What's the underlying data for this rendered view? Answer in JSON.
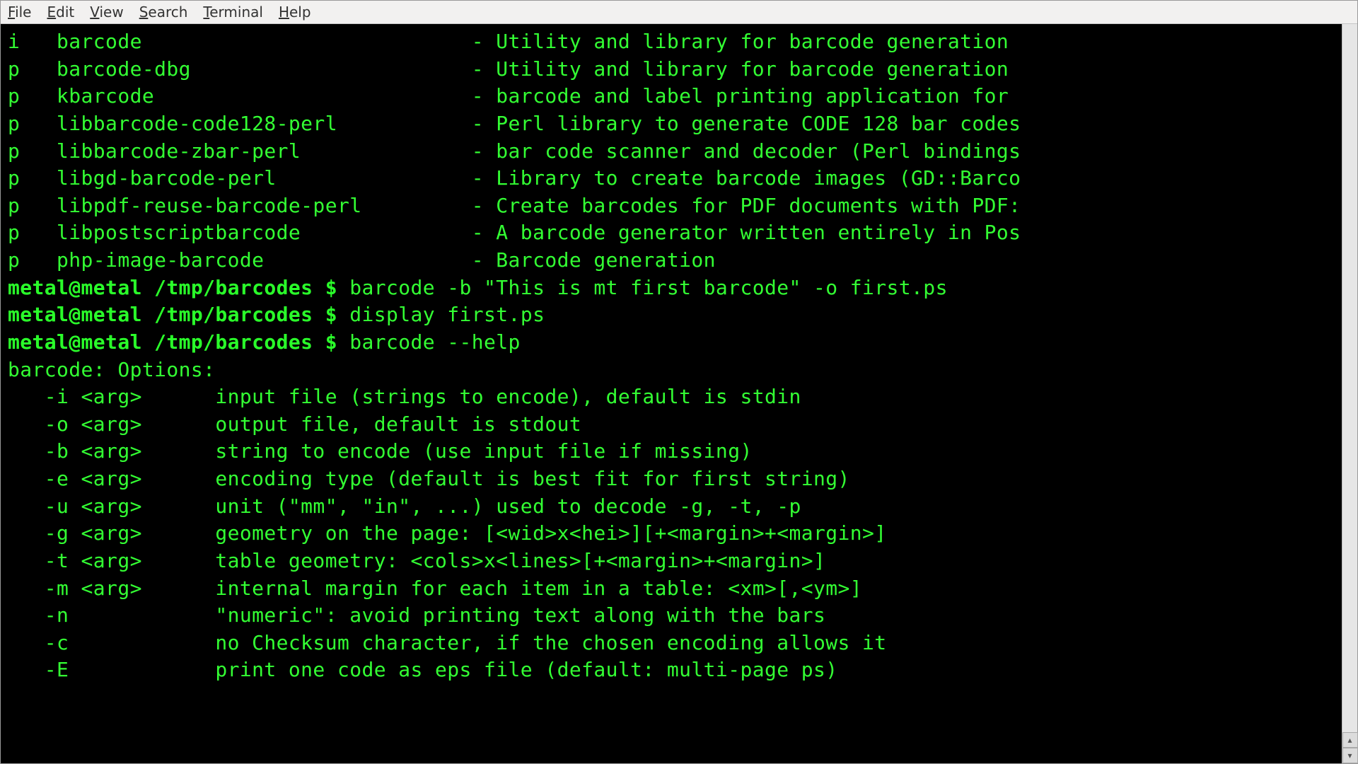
{
  "menu": {
    "file": "File",
    "edit": "Edit",
    "view": "View",
    "search": "Search",
    "terminal": "Terminal",
    "help": "Help"
  },
  "packages": [
    {
      "state": "i",
      "name": "barcode",
      "desc": "Utility and library for barcode generation"
    },
    {
      "state": "p",
      "name": "barcode-dbg",
      "desc": "Utility and library for barcode generation"
    },
    {
      "state": "p",
      "name": "kbarcode",
      "desc": "barcode and label printing application for"
    },
    {
      "state": "p",
      "name": "libbarcode-code128-perl",
      "desc": "Perl library to generate CODE 128 bar codes"
    },
    {
      "state": "p",
      "name": "libbarcode-zbar-perl",
      "desc": "bar code scanner and decoder (Perl bindings"
    },
    {
      "state": "p",
      "name": "libgd-barcode-perl",
      "desc": "Library to create barcode images (GD::Barco"
    },
    {
      "state": "p",
      "name": "libpdf-reuse-barcode-perl",
      "desc": "Create barcodes for PDF documents with PDF:"
    },
    {
      "state": "p",
      "name": "libpostscriptbarcode",
      "desc": "A barcode generator written entirely in Pos"
    },
    {
      "state": "p",
      "name": "php-image-barcode",
      "desc": "Barcode generation"
    }
  ],
  "prompt": {
    "user_host": "metal@metal",
    "cwd": "/tmp/barcodes",
    "sigil": "$"
  },
  "commands": [
    "barcode -b \"This is mt first barcode\" -o first.ps",
    "display first.ps",
    "barcode --help"
  ],
  "help": {
    "header": "barcode: Options:",
    "options": [
      {
        "flag": "-i <arg>",
        "desc": "input file (strings to encode), default is stdin"
      },
      {
        "flag": "-o <arg>",
        "desc": "output file, default is stdout"
      },
      {
        "flag": "-b <arg>",
        "desc": "string to encode (use input file if missing)"
      },
      {
        "flag": "-e <arg>",
        "desc": "encoding type (default is best fit for first string)"
      },
      {
        "flag": "-u <arg>",
        "desc": "unit (\"mm\", \"in\", ...) used to decode -g, -t, -p"
      },
      {
        "flag": "-g <arg>",
        "desc": "geometry on the page: [<wid>x<hei>][+<margin>+<margin>]"
      },
      {
        "flag": "-t <arg>",
        "desc": "table geometry: <cols>x<lines>[+<margin>+<margin>]"
      },
      {
        "flag": "-m <arg>",
        "desc": "internal margin for each item in a table: <xm>[,<ym>]"
      },
      {
        "flag": "-n",
        "desc": "\"numeric\": avoid printing text along with the bars"
      },
      {
        "flag": "-c",
        "desc": "no Checksum character, if the chosen encoding allows it"
      },
      {
        "flag": "-E",
        "desc": "print one code as eps file (default: multi-page ps)"
      }
    ]
  },
  "scrollbar": {
    "up": "▴",
    "down": "▾"
  }
}
